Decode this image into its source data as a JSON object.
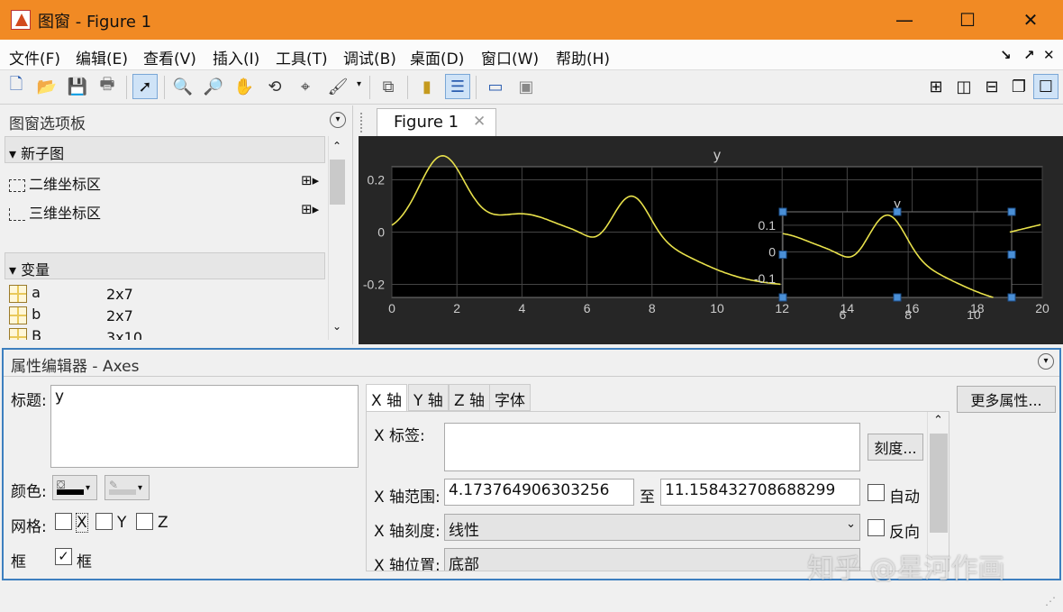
{
  "window": {
    "title": "图窗 - Figure 1"
  },
  "menu": [
    "文件(F)",
    "编辑(E)",
    "查看(V)",
    "插入(I)",
    "工具(T)",
    "调试(B)",
    "桌面(D)",
    "窗口(W)",
    "帮助(H)"
  ],
  "palette": {
    "title": "图窗选项板",
    "new_subplot": "新子图",
    "axes2d": "二维坐标区",
    "axes3d": "三维坐标区",
    "variables": "变量",
    "vars": [
      {
        "name": "a",
        "size": "2x7"
      },
      {
        "name": "b",
        "size": "2x7"
      },
      {
        "name": "B",
        "size": "3x10"
      }
    ]
  },
  "figure_tab": "Figure 1",
  "plot": {
    "title": "y",
    "xticks": [
      "0",
      "2",
      "4",
      "6",
      "8",
      "10",
      "12",
      "14",
      "16",
      "18",
      "20"
    ],
    "yticks": [
      "0.2",
      "0",
      "-0.2"
    ],
    "inset_title": "y",
    "inset_yticks": [
      "0.1",
      "0",
      "-0.1"
    ],
    "inset_xticks": [
      "6",
      "8",
      "10"
    ],
    "line_color": "#e8e14b"
  },
  "prop": {
    "title": "属性编辑器 - Axes",
    "title_label": "标题:",
    "title_value": "y",
    "color_label": "颜色:",
    "grid_label": "网格:",
    "grid_x": "X",
    "grid_y": "Y",
    "grid_z": "Z",
    "box_label": "框",
    "box_check": "框",
    "tabs": [
      "X 轴",
      "Y 轴",
      "Z 轴",
      "字体"
    ],
    "xlabel_label": "X 标签:",
    "ticks_button": "刻度...",
    "range_label": "X 轴范围:",
    "range_min": "4.173764906303256",
    "range_to": "至",
    "range_max": "11.158432708688299",
    "auto": "自动",
    "scale_label": "X 轴刻度:",
    "scale_value": "线性",
    "reverse": "反向",
    "location_label": "X 轴位置:",
    "location_value": "底部",
    "more_props": "更多属性..."
  },
  "watermark": "知乎 @星河作画"
}
